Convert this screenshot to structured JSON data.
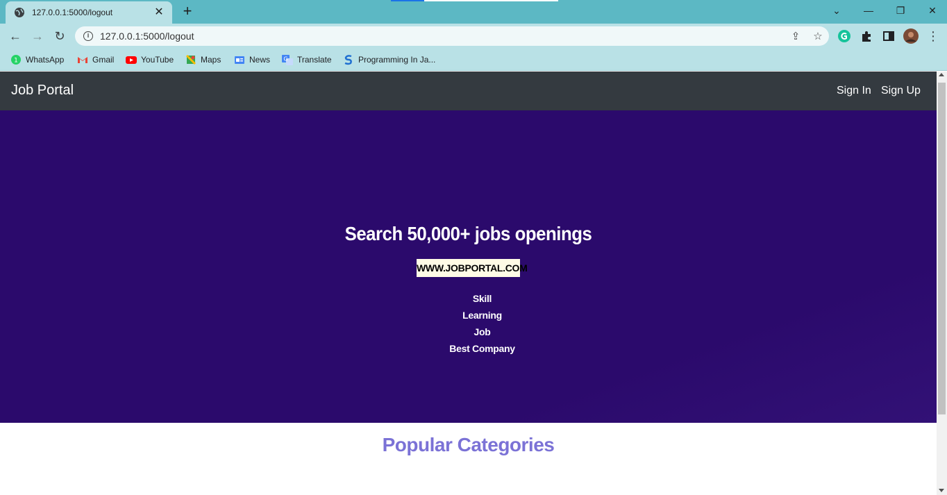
{
  "browser": {
    "tab": {
      "title": "127.0.0.1:5000/logout"
    },
    "url": "127.0.0.1:5000/logout",
    "bookmarks": [
      {
        "label": "WhatsApp",
        "icon": "whatsapp-icon"
      },
      {
        "label": "Gmail",
        "icon": "gmail-icon"
      },
      {
        "label": "YouTube",
        "icon": "youtube-icon"
      },
      {
        "label": "Maps",
        "icon": "maps-icon"
      },
      {
        "label": "News",
        "icon": "news-icon"
      },
      {
        "label": "Translate",
        "icon": "translate-icon"
      },
      {
        "label": "Programming In Ja...",
        "icon": "s-logo-icon"
      }
    ],
    "glyphs": {
      "new_tab": "+",
      "close": "✕",
      "back": "←",
      "forward": "→",
      "reload": "↻",
      "share": "⇪",
      "star": "☆",
      "menu": "⋮",
      "minimize": "—",
      "restore": "❐",
      "win_close": "✕",
      "tab_list": "⌄",
      "info": "i"
    }
  },
  "site": {
    "brand": "Job Portal",
    "nav": {
      "sign_in": "Sign In",
      "sign_up": "Sign Up"
    },
    "hero": {
      "title": "Search 50,000+ jobs openings",
      "badge": "WWW.JOBPORTAL.COM",
      "items": [
        "Skill",
        "Learning",
        "Job",
        "Best Company"
      ]
    },
    "categories_title": "Popular Categories"
  },
  "colors": {
    "tab_strip": "#5cb8c4",
    "toolbar": "#b9e1e6",
    "navbar": "#343a40",
    "hero_bg": "#2b0a6c",
    "badge_bg": "#fffbe6",
    "section_title": "#7b72d6"
  }
}
